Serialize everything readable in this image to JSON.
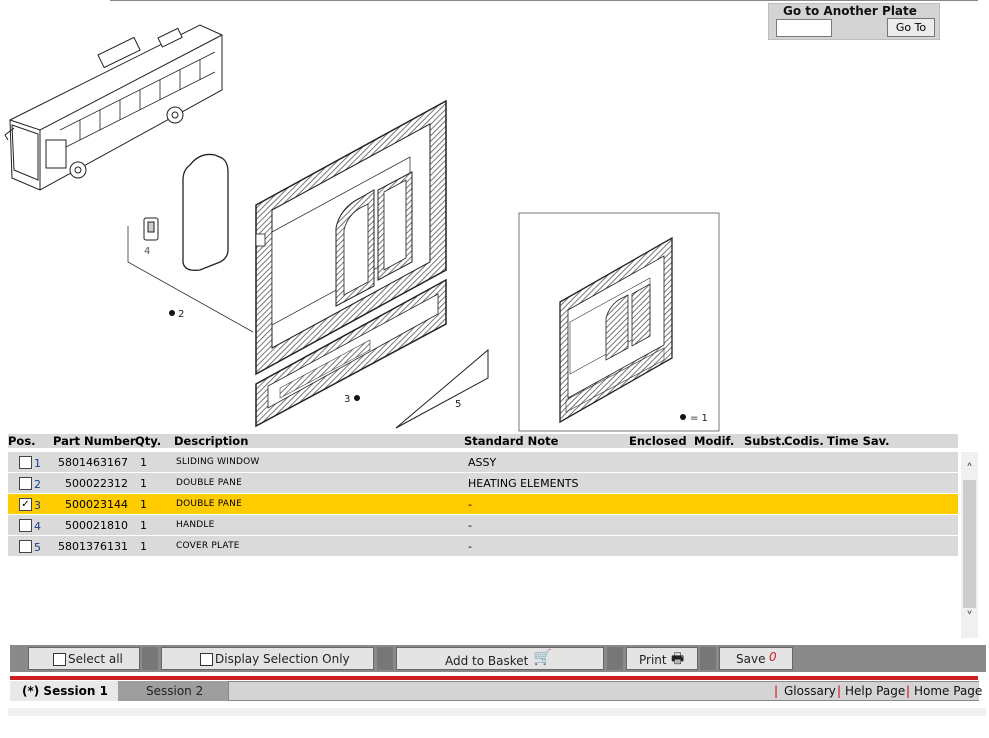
{
  "goto": {
    "title": "Go to Another Plate",
    "input_value": "",
    "button_label": "Go To"
  },
  "drawing": {
    "callouts": [
      "4",
      "2",
      "3",
      "5",
      "= 1"
    ]
  },
  "table": {
    "headers": {
      "pos": "Pos.",
      "part_number": "Part Number",
      "qty": "Qty.",
      "description": "Description",
      "standard_note": "Standard Note",
      "enclosed": "Enclosed",
      "modif": "Modif.",
      "subst": "Subst.",
      "codis": "Codis.",
      "time_sav": "Time Sav."
    },
    "rows": [
      {
        "pos": "1",
        "part_number": "5801463167",
        "qty": "1",
        "description": "SLIDING WINDOW",
        "note": "ASSY",
        "checked": false
      },
      {
        "pos": "2",
        "part_number": "500022312",
        "qty": "1",
        "description": "DOUBLE PANE",
        "note": "HEATING ELEMENTS",
        "checked": false
      },
      {
        "pos": "3",
        "part_number": "500023144",
        "qty": "1",
        "description": "DOUBLE PANE",
        "note": "-",
        "checked": true
      },
      {
        "pos": "4",
        "part_number": "500021810",
        "qty": "1",
        "description": "HANDLE",
        "note": "-",
        "checked": false
      },
      {
        "pos": "5",
        "part_number": "5801376131",
        "qty": "1",
        "description": "COVER PLATE",
        "note": "-",
        "checked": false
      }
    ],
    "selected_row_color": "#ffcc00"
  },
  "toolbar": {
    "select_all": "Select all",
    "display_selection_only": "Display Selection Only",
    "add_to_basket": "Add to Basket",
    "print": "Print",
    "save": "Save",
    "save_count": "0"
  },
  "session": {
    "tab1": "(*) Session 1",
    "tab2": "Session 2",
    "links": [
      "Glossary",
      "Help Page",
      "Home Page"
    ],
    "accent": "#cc1f1f"
  }
}
